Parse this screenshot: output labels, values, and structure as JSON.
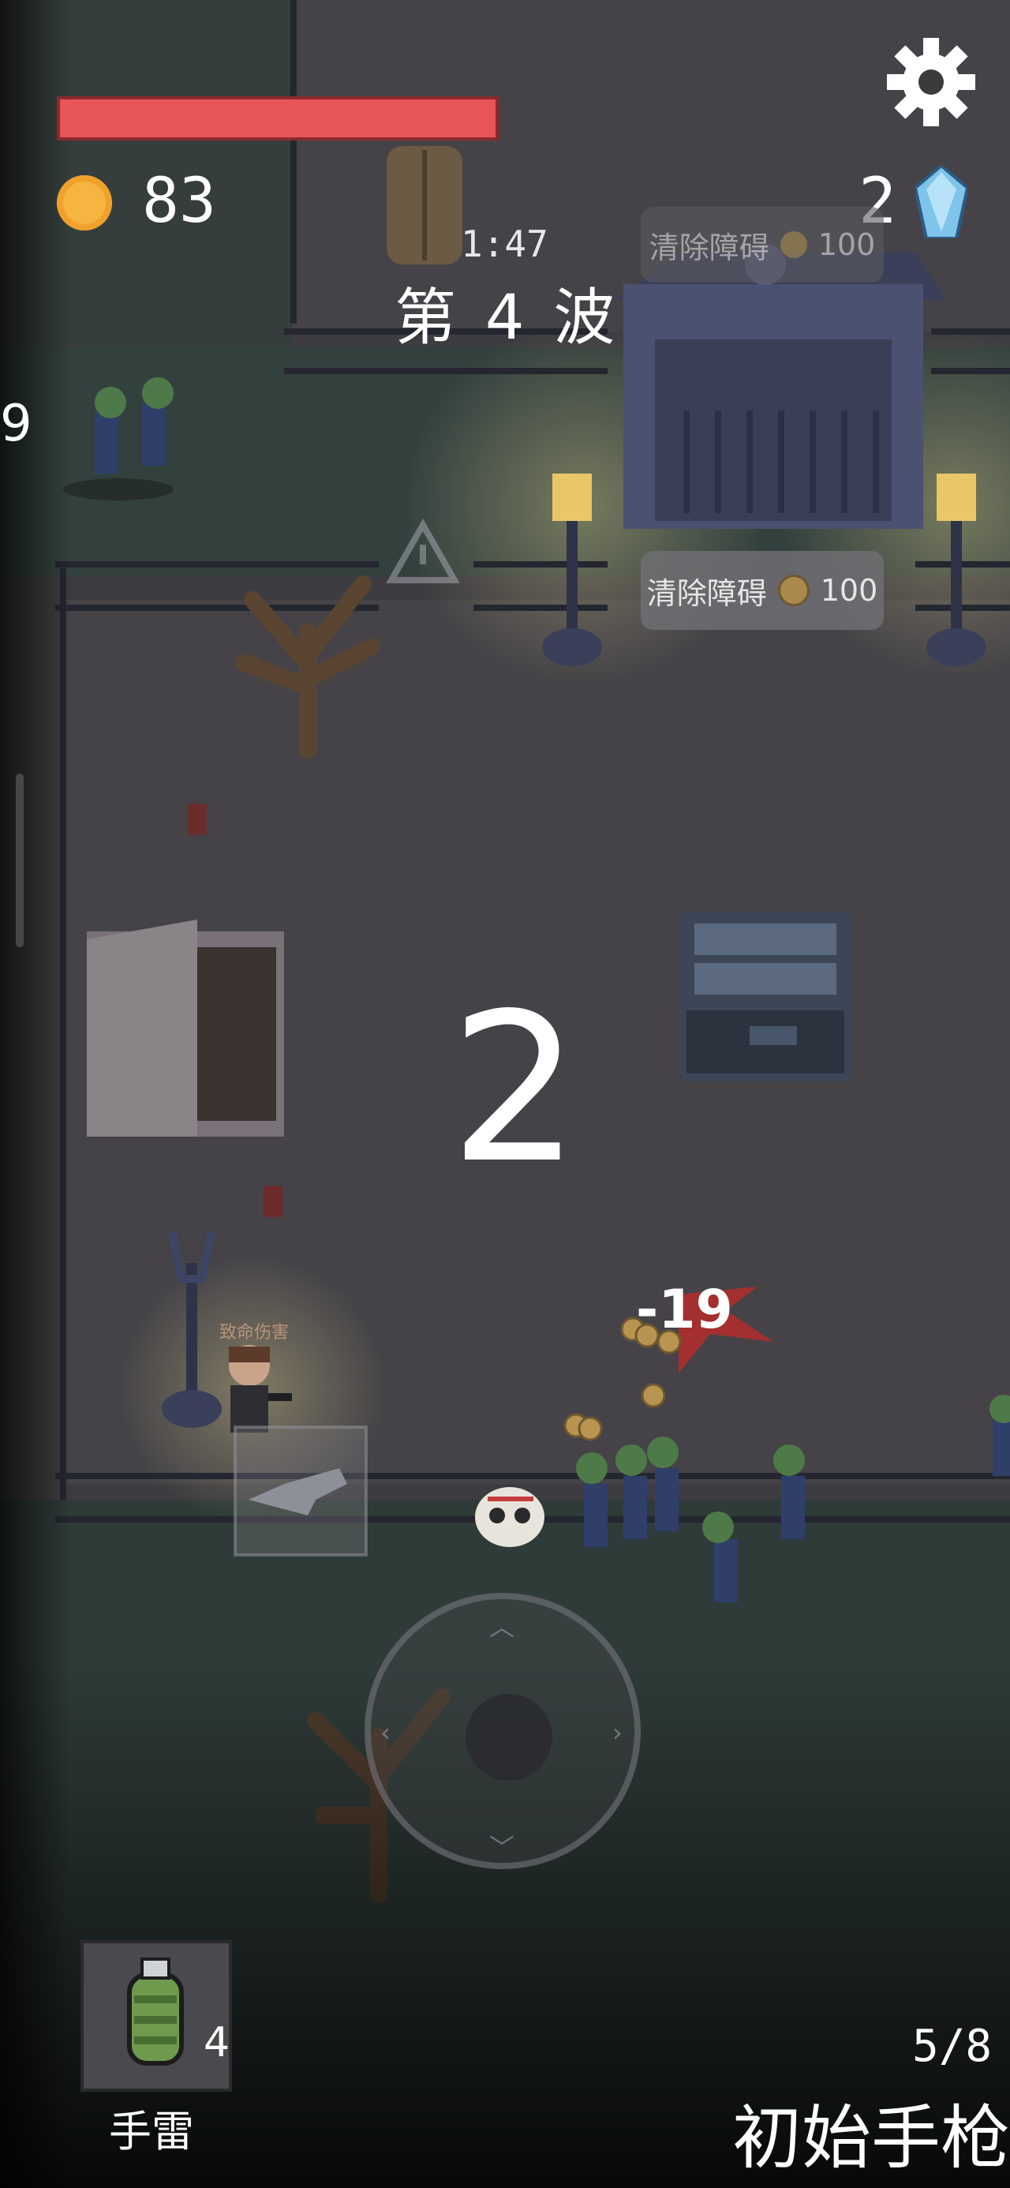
{
  "hud": {
    "health_fraction": 1.0,
    "coins": "83",
    "gems": "2",
    "timer": "1:47",
    "wave_prefix": "第",
    "wave_number": "4",
    "wave_suffix": "波",
    "left_edge_number": "9"
  },
  "world": {
    "clear_obstacle_label": "清除障碍",
    "clear_obstacle_cost": "100",
    "clear_obstacle_ghost_label": "清除障碍",
    "clear_obstacle_ghost_cost": "100",
    "countdown": "2",
    "damage_popup": "-19",
    "crit_label": "致命伤害"
  },
  "inventory": {
    "grenade_count": "4",
    "grenade_label": "手雷",
    "ammo": "5/8",
    "weapon_name": "初始手枪"
  },
  "colors": {
    "health": "#e85558",
    "coin": "#f6b441",
    "gem": "#7fc4ea",
    "ground": "#3b3a3d"
  }
}
